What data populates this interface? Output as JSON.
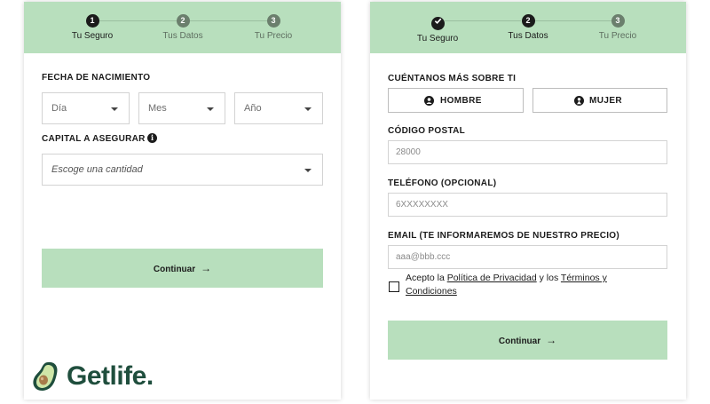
{
  "steps": {
    "one": {
      "label": "Tu Seguro",
      "number": "1"
    },
    "two": {
      "label": "Tus Datos",
      "number": "2"
    },
    "three": {
      "label": "Tu Precio",
      "number": "3"
    }
  },
  "form1": {
    "birth_label": "FECHA DE NACIMIENTO",
    "day_value": "Día",
    "month_value": "Mes",
    "year_value": "Año",
    "capital_label": "CAPITAL A ASEGURAR",
    "info_glyph": "i",
    "amount_value": "Escoge una cantidad",
    "continue_label": "Continuar",
    "arrow_glyph": "→"
  },
  "form2": {
    "about_label": "CUÉNTANOS MÁS SOBRE TI",
    "male_label": "HOMBRE",
    "female_label": "MUJER",
    "postal_label": "CÓDIGO POSTAL",
    "postal_placeholder": "28000",
    "phone_label": "TELÉFONO (OPCIONAL)",
    "phone_placeholder": "6XXXXXXXX",
    "email_label": "EMAIL (TE INFORMAREMOS DE NUESTRO PRECIO)",
    "email_placeholder": "aaa@bbb.ccc",
    "terms_prefix": "Acepto la ",
    "privacy_link": "Política de Privacidad",
    "terms_middle": " y los ",
    "terms_link": "Términos y Condiciones",
    "continue_label": "Continuar",
    "arrow_glyph": "→"
  },
  "brand": {
    "name": "Getlife."
  },
  "icons": {
    "male": "male-person-icon",
    "female": "female-person-icon",
    "check": "checkmark-icon",
    "info": "info-icon",
    "logo": "avocado-icon"
  },
  "colors": {
    "header_green": "#b8dfbd",
    "button_green": "#b8dfbd",
    "active_dot": "#1b1b1b",
    "inactive_dot": "#6b7f6d",
    "brand_text": "#1f4e3d"
  }
}
